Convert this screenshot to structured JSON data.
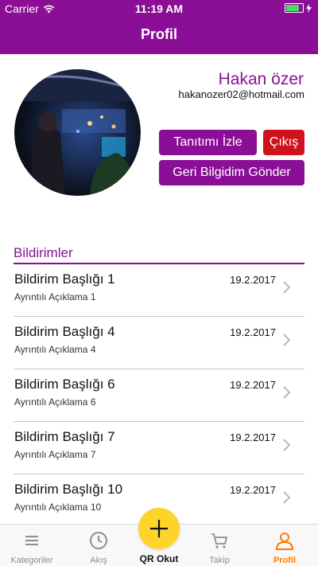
{
  "status_bar": {
    "carrier": "Carrier",
    "time": "11:19 AM",
    "battery_level": 0.8
  },
  "nav": {
    "title": "Profil"
  },
  "profile": {
    "name": "Hakan özer",
    "email": "hakanozer02@hotmail.com",
    "avatar_icon": "profile-photo"
  },
  "buttons": {
    "intro_label": "Tanıtımı İzle",
    "exit_label": "Çıkış",
    "feedback_label": "Geri Bilgidim Gönder"
  },
  "notifications": {
    "section_title": "Bildirimler",
    "items": [
      {
        "title": "Bildirim Başlığı 1",
        "date": "19.2.2017",
        "description": "Ayrıntılı Açıklama 1"
      },
      {
        "title": "Bildirim Başlığı 4",
        "date": "19.2.2017",
        "description": "Ayrıntılı Açıklama 4"
      },
      {
        "title": "Bildirim Başlığı 6",
        "date": "19.2.2017",
        "description": "Ayrıntılı Açıklama 6"
      },
      {
        "title": "Bildirim Başlığı 7",
        "date": "19.2.2017",
        "description": "Ayrıntılı Açıklama 7"
      },
      {
        "title": "Bildirim Başlığı 10",
        "date": "19.2.2017",
        "description": "Ayrıntılı Açıklama 10"
      }
    ]
  },
  "tabbar": {
    "items": [
      {
        "label": "Kategoriler",
        "icon": "menu-icon"
      },
      {
        "label": "Akış",
        "icon": "clock-icon"
      },
      {
        "label": "QR Okut",
        "icon": "plus-icon"
      },
      {
        "label": "Takip",
        "icon": "cart-icon"
      },
      {
        "label": "Profil",
        "icon": "user-icon"
      }
    ],
    "active": "Profil"
  },
  "colors": {
    "brand": "#8a0f96",
    "danger": "#d0111e",
    "active_tab": "#ff7a00",
    "fab": "#ffd42a"
  }
}
